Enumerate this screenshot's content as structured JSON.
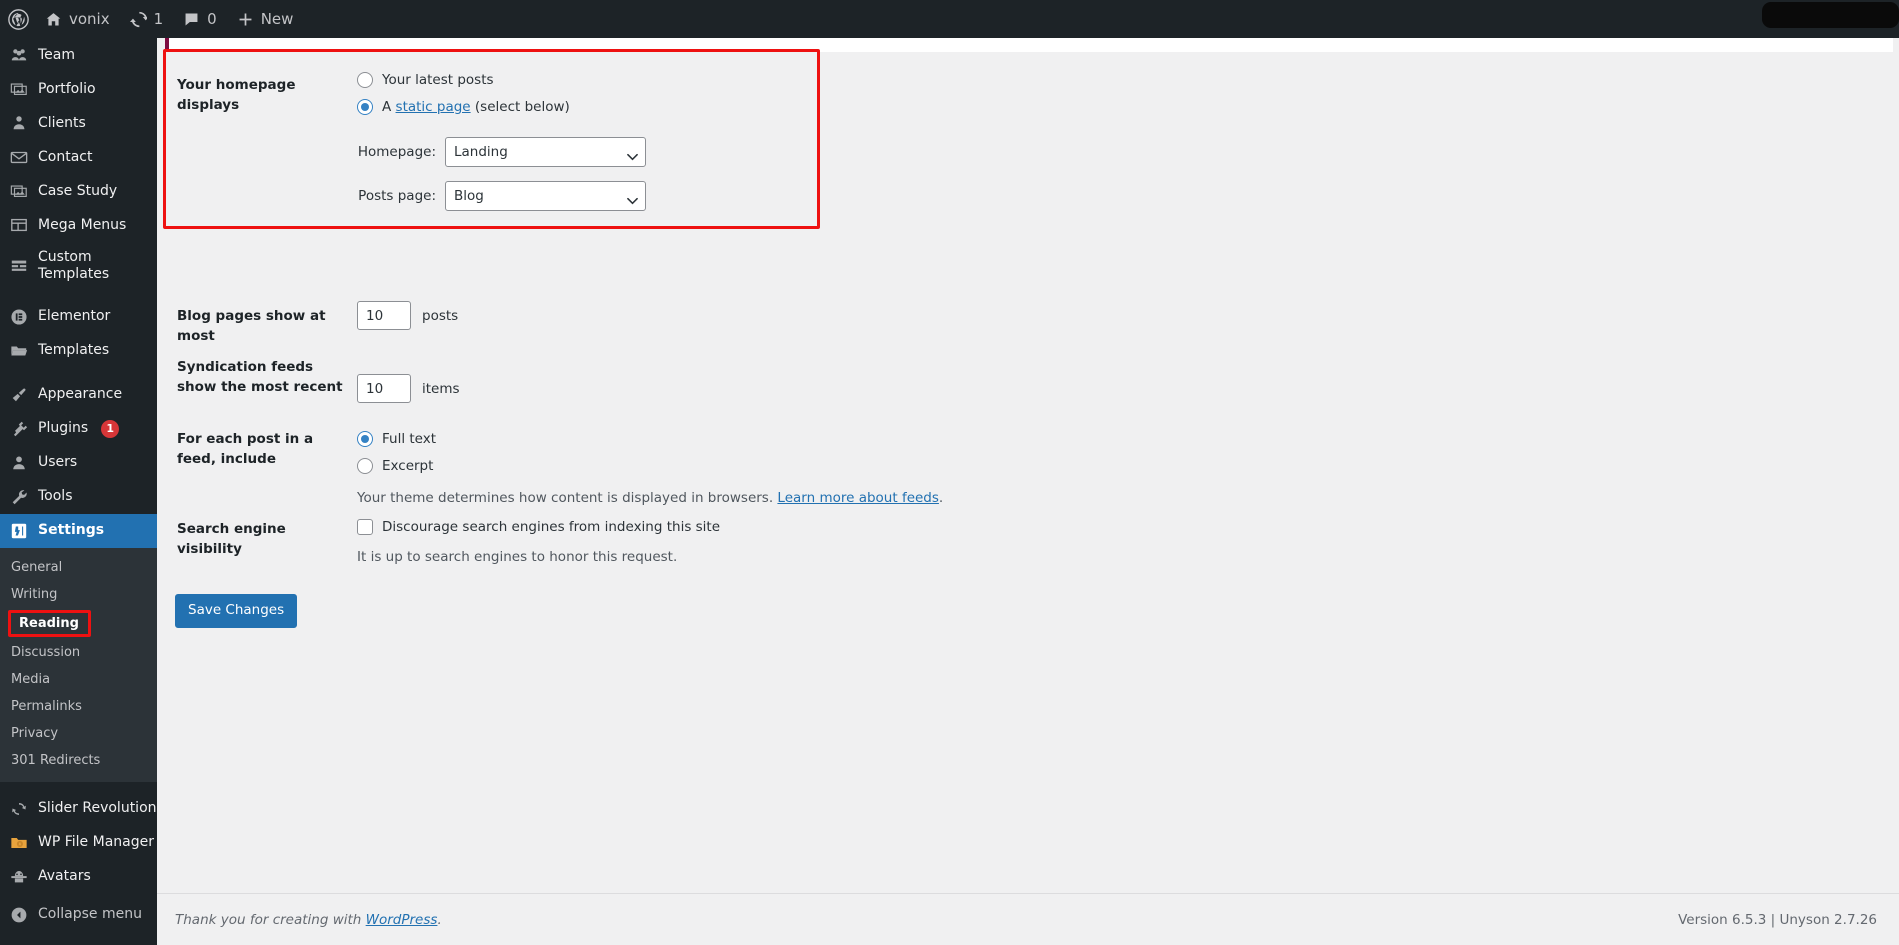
{
  "adminbar": {
    "wp_logo": "wordpress-logo-icon",
    "site_name": "vonix",
    "updates_count": "1",
    "comments_count": "0",
    "new_label": "New"
  },
  "sidebar": {
    "items": [
      {
        "label": "Team",
        "icon": "group-icon"
      },
      {
        "label": "Portfolio",
        "icon": "images-icon"
      },
      {
        "label": "Clients",
        "icon": "person-icon"
      },
      {
        "label": "Contact",
        "icon": "envelope-icon"
      },
      {
        "label": "Case Study",
        "icon": "images-icon"
      },
      {
        "label": "Mega Menus",
        "icon": "grid-icon"
      },
      {
        "label": "Custom Templates",
        "icon": "list-icon"
      },
      {
        "label": "Elementor",
        "icon": "elementor-icon"
      },
      {
        "label": "Templates",
        "icon": "folder-icon"
      },
      {
        "label": "Appearance",
        "icon": "paintbrush-icon"
      },
      {
        "label": "Plugins",
        "icon": "plug-icon",
        "badge": "1"
      },
      {
        "label": "Users",
        "icon": "user-icon"
      },
      {
        "label": "Tools",
        "icon": "wrench-icon"
      },
      {
        "label": "Settings",
        "icon": "settings-icon",
        "current": true
      }
    ],
    "submenu": [
      {
        "label": "General"
      },
      {
        "label": "Writing"
      },
      {
        "label": "Reading",
        "current": true,
        "highlighted": true
      },
      {
        "label": "Discussion"
      },
      {
        "label": "Media"
      },
      {
        "label": "Permalinks"
      },
      {
        "label": "Privacy"
      },
      {
        "label": "301 Redirects"
      }
    ],
    "bottom_items": [
      {
        "label": "Slider Revolution",
        "icon": "refresh-icon"
      },
      {
        "label": "WP File Manager",
        "icon": "folder-orange-icon"
      },
      {
        "label": "Avatars",
        "icon": "avatar-icon"
      }
    ],
    "collapse_label": "Collapse menu",
    "collapse_icon": "chevron-left-circle-icon"
  },
  "main": {
    "homepage_displays": {
      "label": "Your homepage displays",
      "option_latest_posts": "Your latest posts",
      "option_static_prefix": "A ",
      "option_static_link": "static page",
      "option_static_suffix": " (select below)",
      "selected": "static_page",
      "homepage_label": "Homepage:",
      "homepage_value": "Landing",
      "posts_page_label": "Posts page:",
      "posts_page_value": "Blog"
    },
    "blog_pages": {
      "label": "Blog pages show at most",
      "value": "10",
      "unit": "posts"
    },
    "syndication": {
      "label": "Syndication feeds show the most recent",
      "value": "10",
      "unit": "items"
    },
    "feed_include": {
      "label": "For each post in a feed, include",
      "option_full_text": "Full text",
      "option_excerpt": "Excerpt",
      "selected": "full_text",
      "helper_prefix": "Your theme determines how content is displayed in browsers. ",
      "helper_link": "Learn more about feeds",
      "helper_suffix": "."
    },
    "search_visibility": {
      "label": "Search engine visibility",
      "checkbox_label": "Discourage search engines from indexing this site",
      "checked": false,
      "helper": "It is up to search engines to honor this request."
    },
    "save_label": "Save Changes"
  },
  "footer": {
    "thanks_prefix": "Thank you for creating with ",
    "thanks_link": "WordPress",
    "thanks_suffix": ".",
    "version": "Version 6.5.3 | Unyson 2.7.26"
  },
  "colors": {
    "admin_dark": "#1d2327",
    "submenu_dark": "#2c3338",
    "accent_blue": "#2271b1",
    "highlight_red": "#ee1111",
    "badge_red": "#d63638",
    "content_bg": "#f0f0f1"
  }
}
